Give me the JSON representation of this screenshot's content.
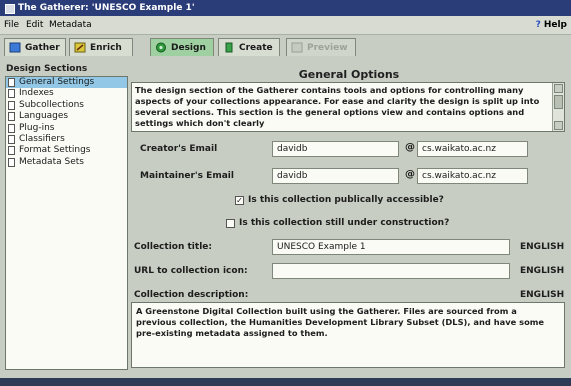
{
  "window": {
    "title": "The Gatherer: 'UNESCO Example 1'"
  },
  "menu": {
    "file": "File",
    "edit": "Edit",
    "metadata": "Metadata",
    "help": "Help"
  },
  "tabs": [
    {
      "label": "Gather",
      "state": "normal"
    },
    {
      "label": "Enrich",
      "state": "normal"
    },
    {
      "label": "Design",
      "state": "active"
    },
    {
      "label": "Create",
      "state": "normal"
    },
    {
      "label": "Preview",
      "state": "disabled"
    }
  ],
  "sidebar": {
    "title": "Design Sections",
    "items": [
      {
        "label": "General Settings",
        "selected": true
      },
      {
        "label": "Indexes"
      },
      {
        "label": "Subcollections"
      },
      {
        "label": "Languages"
      },
      {
        "label": "Plug-ins"
      },
      {
        "label": "Classifiers"
      },
      {
        "label": "Format Settings"
      },
      {
        "label": "Metadata Sets"
      }
    ]
  },
  "general": {
    "heading": "General Options",
    "description": "The design section of the Gatherer contains tools and options for controlling many aspects of your collections appearance. For ease and clarity the design is split up into several sections. This section is the general options view and contains options and settings which don't clearly",
    "creator_label": "Creator's Email",
    "creator_user": "davidb",
    "creator_domain": "cs.waikato.ac.nz",
    "maintainer_label": "Maintainer's Email",
    "maintainer_user": "davidb",
    "maintainer_domain": "cs.waikato.ac.nz",
    "at_symbol": "@",
    "public_label": "Is this collection publically accessible?",
    "public_checked": true,
    "construction_label": "Is this collection still under construction?",
    "construction_checked": false,
    "title_label": "Collection title:",
    "title_value": "UNESCO Example 1",
    "title_lang": "ENGLISH",
    "icon_label": "URL to collection icon:",
    "icon_value": "",
    "icon_lang": "ENGLISH",
    "coll_desc_label": "Collection description:",
    "coll_desc_lang": "ENGLISH",
    "coll_desc_value": "A Greenstone Digital Collection built using the Gatherer. Files are sourced from a previous collection, the Humanities Development Library Subset (DLS), and have some pre-existing metadata assigned to them."
  },
  "colors": {
    "titlebar": "#2b3d78",
    "window_bg": "#c7cdc2",
    "active_tab": "#9fd0a1",
    "selection": "#92c8e6"
  },
  "icons": {
    "gather": "gather-icon",
    "enrich": "enrich-icon",
    "design": "design-icon",
    "create": "create-icon",
    "preview": "preview-icon",
    "help": "help-icon",
    "document": "document-icon"
  }
}
